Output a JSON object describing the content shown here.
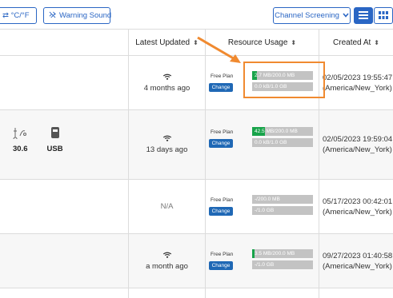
{
  "toolbar": {
    "unit_label": "⇄ °C/°F",
    "warning_label": "Warning Sound",
    "channel_label": "Channel Screening",
    "colors": {
      "accent": "#2a66c4"
    }
  },
  "table": {
    "headers": {
      "latest_updated": "Latest Updated",
      "resource_usage": "Resource Usage",
      "created_at": "Created At"
    },
    "rows": [
      {
        "updated": "4 months ago",
        "plan": "Free Plan",
        "change": "Change",
        "usage1": "2.7 MB/200.0 MB",
        "usage1_pct": 1.35,
        "usage2": "0.0 kB/1.0 GB",
        "created_date": "02/05/2023 19:55:47",
        "created_tz": "(America/New_York)"
      },
      {
        "device_value": "30.6",
        "device_usb": "USB",
        "updated": "13 days ago",
        "plan": "Free Plan",
        "change": "Change",
        "usage1": "42.5 MB/200.0 MB",
        "usage1_pct": 21.25,
        "usage2": "0.0 kB/1.0 GB",
        "created_date": "02/05/2023 19:59:04",
        "created_tz": "(America/New_York)"
      },
      {
        "updated": "N/A",
        "plan": "Free Plan",
        "change": "Change",
        "usage1": "-/200.0 MB",
        "usage1_pct": 0,
        "usage2": "-/1.0 GB",
        "created_date": "05/17/2023 00:42:01",
        "created_tz": "(America/New_York)"
      },
      {
        "updated": "a month ago",
        "plan": "Free Plan",
        "change": "Change",
        "usage1": "3.5 MB/200.0 MB",
        "usage1_pct": 1.75,
        "usage2": "-/1.0 GB",
        "created_date": "09/27/2023 01:40:58",
        "created_tz": "(America/New_York)"
      }
    ]
  },
  "annotation": {
    "color": "#f08a30"
  },
  "icons": [
    "swap-icon",
    "mute-icon",
    "chevron-down-icon",
    "list-view-icon",
    "grid-view-icon",
    "wifi-icon",
    "sensor-icon",
    "usb-icon",
    "sort-icon",
    "arrow-annotation"
  ]
}
